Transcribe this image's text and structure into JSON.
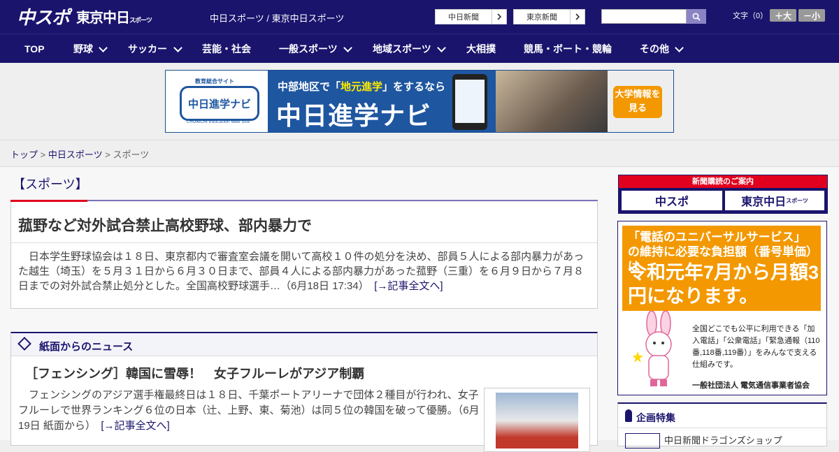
{
  "header": {
    "logo_chunichi_sports": "中スポ",
    "logo_tokyo_chunichi": "東京中日",
    "logo_tokyo_suffix": "スポーツ",
    "site_name": "中日スポーツ / 東京中日スポーツ",
    "link_chunichi_shimbun": "中日新聞",
    "link_tokyo_shimbun": "東京新聞",
    "search_placeholder": "",
    "font_size_label": "文字（0）",
    "font_larger": "＋大",
    "font_smaller": "－小"
  },
  "nav": {
    "items": [
      {
        "label": "TOP",
        "dropdown": false
      },
      {
        "label": "野球",
        "dropdown": true
      },
      {
        "label": "サッカー",
        "dropdown": true
      },
      {
        "label": "芸能・社会",
        "dropdown": false
      },
      {
        "label": "一般スポーツ",
        "dropdown": true
      },
      {
        "label": "地域スポーツ",
        "dropdown": true
      },
      {
        "label": "大相撲",
        "dropdown": false
      },
      {
        "label": "競馬・ボート・競輪",
        "dropdown": false
      },
      {
        "label": "その他",
        "dropdown": true
      }
    ]
  },
  "banner": {
    "logo_top": "教育総合サイト",
    "logo_main": "中日進学ナビ",
    "logo_sub": "CHUNICHI Education Web Site",
    "line1_pre": "中部地区で「",
    "line1_em": "地元進学",
    "line1_post": "」をするなら",
    "line2": "中日進学ナビ",
    "cta": "大学情報を見る"
  },
  "breadcrumb": {
    "top": "トップ",
    "chunichi_sports": "中日スポーツ",
    "current": "スポーツ",
    "separator": ">"
  },
  "section": {
    "title": "【スポーツ】"
  },
  "lead_article": {
    "headline": "菰野など対外試合禁止高校野球、部内暴力で",
    "body": "　日本学生野球協会は１８日、東京都内で審査室会議を開いて高校１０件の処分を決め、部員５人による部内暴力があった越生（埼玉）を５月３１日から６月３０日まで、部員４人による部内暴力があった菰野（三重）を６月９日から７月８日までの対外試合禁止処分とした。全国高校野球選手…（6月18日 17:34）",
    "more": "[→記事全文へ]"
  },
  "paper_news": {
    "section_title": "紙面からのニュース",
    "headline": "［フェンシング］韓国に雪辱！　女子フルーレがアジア制覇",
    "body": "　フェンシングのアジア選手権最終日は１８日、千葉ポートアリーナで団体２種目が行われ、女子フルーレで世界ランキング６位の日本（辻、上野、東、菊池）は同５位の韓国を破って優勝。（6月19日 紙面から）",
    "more": "[→記事全文へ]"
  },
  "sidebar": {
    "subscribe_title": "新聞購読のご案内",
    "subscribe_chunichi": "中スポ",
    "subscribe_tokyo": "東京中日",
    "subscribe_tokyo_suffix": "スポーツ",
    "ad_line1": "「電話のユニバーサルサービス」の維持に必要な負担額（番号単価）は",
    "ad_line2": "令和元年7月から月額3円になります。",
    "ad_small": "全国どこでも公平に利用できる「加入電話」「公衆電話」「緊急通報（110番,118番,119番）」をみんなで支える仕組みです。",
    "ad_org": "一般社団法人 電気通信事業者協会",
    "special_title": "企画特集",
    "special_item": "中日新聞ドラゴンズショップ"
  },
  "colors": {
    "brand_navy": "#1a146d",
    "accent_red": "#e1001d",
    "ad_orange": "#f39800"
  }
}
